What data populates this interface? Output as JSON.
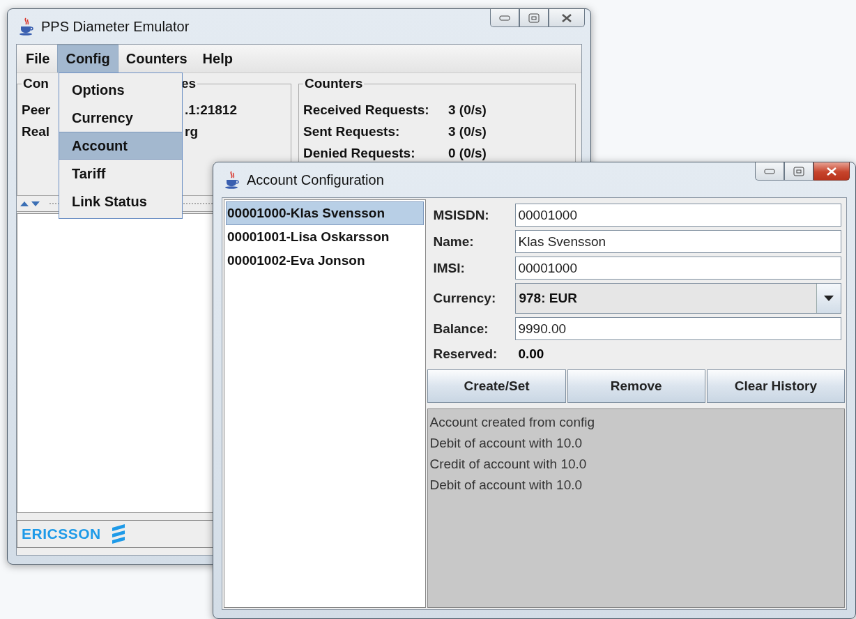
{
  "main_window": {
    "title": "PPS Diameter Emulator",
    "active": false,
    "menu": [
      {
        "label": "File",
        "selected": false
      },
      {
        "label": "Config",
        "selected": true
      },
      {
        "label": "Counters",
        "selected": false
      },
      {
        "label": "Help",
        "selected": false
      }
    ],
    "connection_panel": {
      "title_start": "Con",
      "title_end": "es",
      "rows": [
        {
          "label": "Peer",
          "value": ".1:21812"
        },
        {
          "label": "Real",
          "value": "rg"
        }
      ]
    },
    "counters_panel": {
      "title": "Counters",
      "rows": [
        {
          "label": "Received Requests:",
          "value": "3 (0/s)"
        },
        {
          "label": "Sent Requests:",
          "value": "3 (0/s)"
        },
        {
          "label": "Denied Requests:",
          "value": "0 (0/s)"
        }
      ]
    },
    "status_bar": {
      "logo": "ERICSSON"
    }
  },
  "config_menu": {
    "items": [
      {
        "label": "Options",
        "selected": false
      },
      {
        "label": "Currency",
        "selected": false
      },
      {
        "label": "Account",
        "selected": true
      },
      {
        "label": "Tariff",
        "selected": false
      },
      {
        "label": "Link Status",
        "selected": false
      }
    ]
  },
  "account_window": {
    "title": "Account Configuration",
    "active": true,
    "accounts": [
      {
        "label": "00001000-Klas Svensson",
        "selected": true
      },
      {
        "label": "00001001-Lisa Oskarsson",
        "selected": false
      },
      {
        "label": "00001002-Eva Jonson",
        "selected": false
      }
    ],
    "form": [
      {
        "kind": "text",
        "label": "MSISDN:",
        "value": "00001000"
      },
      {
        "kind": "text",
        "label": "Name:",
        "value": "Klas Svensson"
      },
      {
        "kind": "text",
        "label": "IMSI:",
        "value": "00001000"
      },
      {
        "kind": "combo",
        "label": "Currency:",
        "value": "978: EUR"
      },
      {
        "kind": "text",
        "label": "Balance:",
        "value": "9990.00"
      },
      {
        "kind": "readout",
        "label": "Reserved:",
        "value": "0.00"
      }
    ],
    "buttons": [
      "Create/Set",
      "Remove",
      "Clear History"
    ],
    "history": [
      "Account created from config",
      "Debit of account with 10.0",
      "Credit of account with 10.0",
      "Debit of account with 10.0"
    ]
  }
}
